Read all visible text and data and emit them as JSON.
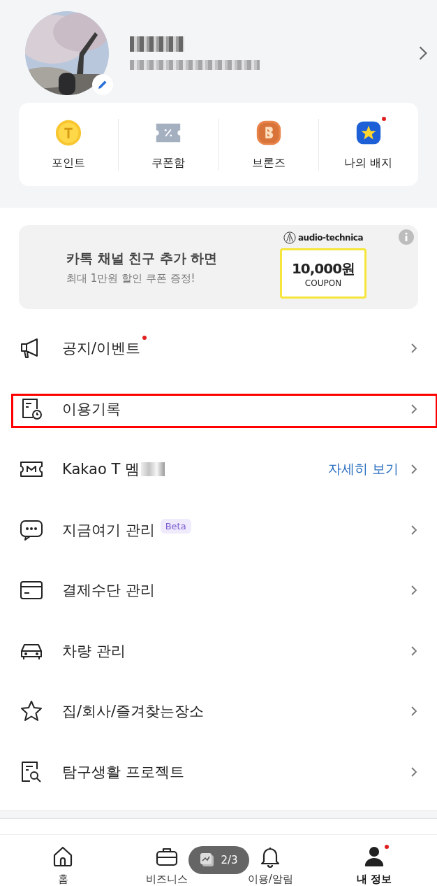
{
  "quick_links": [
    {
      "label": "포인트",
      "kind": "point",
      "dot": false
    },
    {
      "label": "쿠폰함",
      "kind": "coupon",
      "dot": false
    },
    {
      "label": "브론즈",
      "kind": "bronze",
      "dot": false
    },
    {
      "label": "나의 배지",
      "kind": "badge",
      "dot": true
    }
  ],
  "banner": {
    "title": "카톡 채널 친구 추가 하면",
    "subtitle": "최대 1만원 할인 쿠폰 증정!",
    "brand": "audio-technica",
    "amount": "10,000원",
    "coupon": "COUPON"
  },
  "menu": [
    {
      "label": "공지/이벤트",
      "kind": "megaphone",
      "dot": true,
      "highlighted": false,
      "obscured": false
    },
    {
      "label": "이용기록",
      "kind": "receipt",
      "dot": false,
      "highlighted": true,
      "obscured": false
    },
    {
      "label": "Kakao T 멤",
      "kind": "membership",
      "dot": false,
      "highlighted": false,
      "obscured": true,
      "action": "자세히 보기"
    },
    {
      "label": "지금여기 관리",
      "kind": "chat",
      "dot": false,
      "highlighted": false,
      "obscured": false,
      "badge": "Beta"
    },
    {
      "label": "결제수단 관리",
      "kind": "card",
      "dot": false,
      "highlighted": false,
      "obscured": false
    },
    {
      "label": "차량 관리",
      "kind": "car",
      "dot": false,
      "highlighted": false,
      "obscured": false
    },
    {
      "label": "집/회사/즐겨찾는장소",
      "kind": "star",
      "dot": false,
      "highlighted": false,
      "obscured": false
    },
    {
      "label": "탐구생활 프로젝트",
      "kind": "search-doc",
      "dot": false,
      "highlighted": false,
      "obscured": false
    }
  ],
  "nav": [
    {
      "label": "홈",
      "kind": "home",
      "selected": false,
      "dot": false
    },
    {
      "label": "비즈니스",
      "kind": "briefcase",
      "selected": false,
      "dot": false
    },
    {
      "label": "이용/알림",
      "kind": "bell",
      "selected": false,
      "dot": false
    },
    {
      "label": "내 정보",
      "kind": "person",
      "selected": true,
      "dot": true
    }
  ],
  "viewer": {
    "counter": "2/3"
  }
}
